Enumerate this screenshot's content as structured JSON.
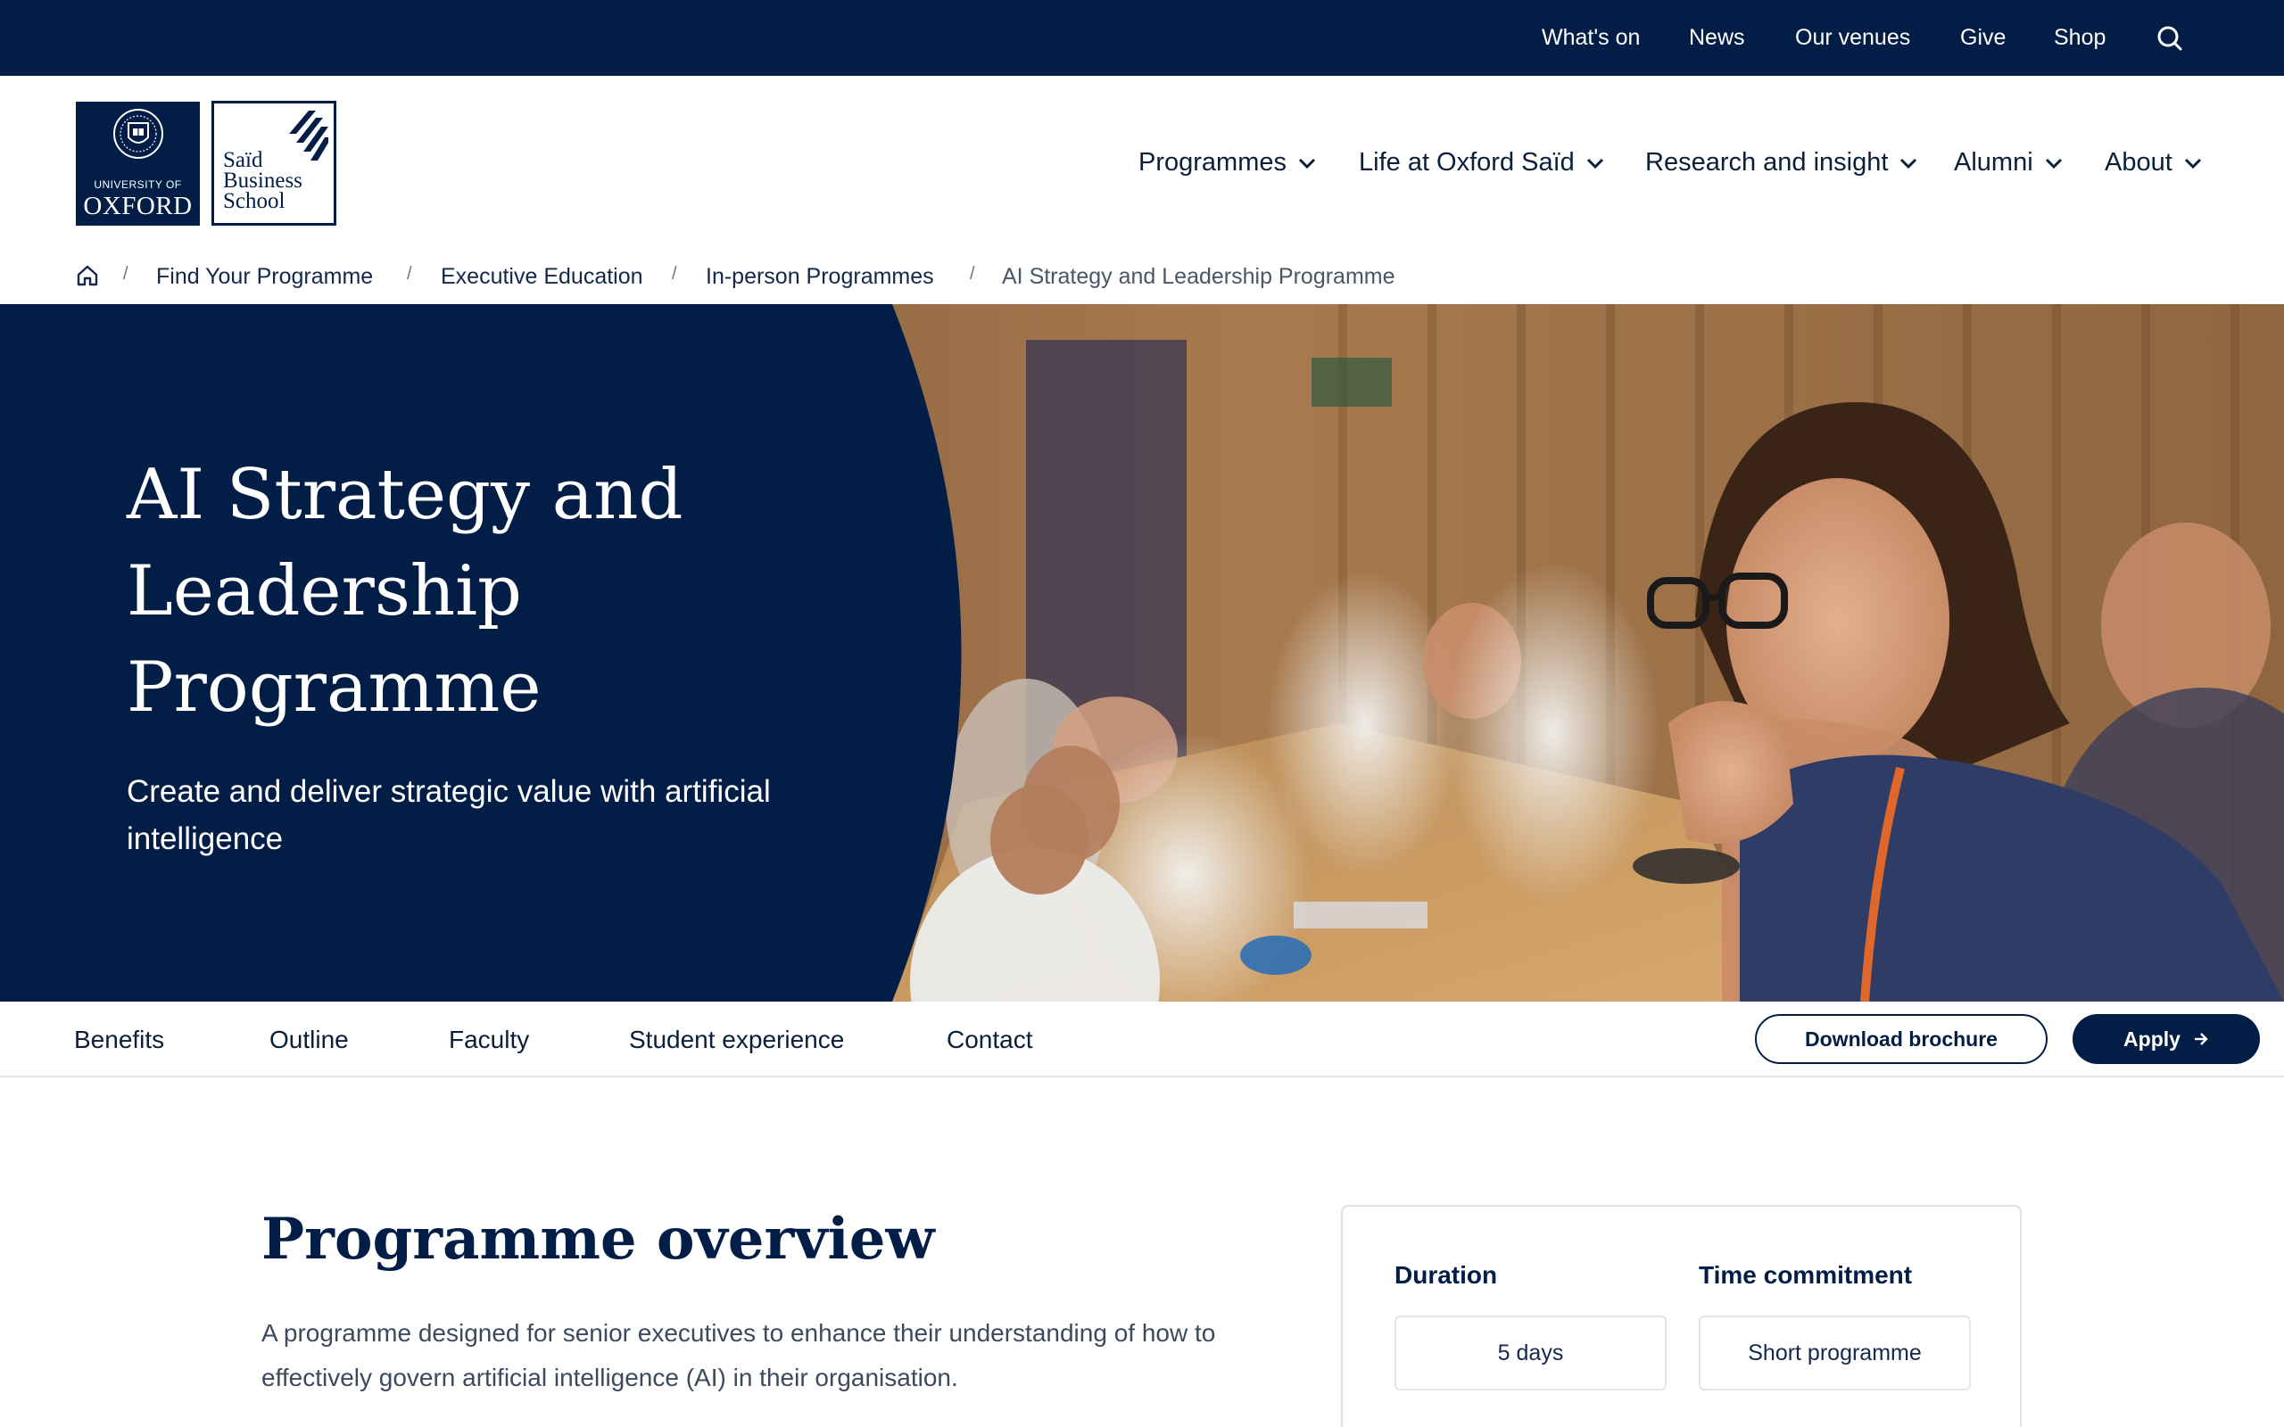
{
  "utility_nav": {
    "items": [
      "What's on",
      "News",
      "Our venues",
      "Give",
      "Shop"
    ],
    "search_icon": "search-icon"
  },
  "logos": {
    "oxford": {
      "line1": "UNIVERSITY OF",
      "line2": "OXFORD"
    },
    "said": {
      "line1": "Saïd",
      "line2": "Business",
      "line3": "School"
    }
  },
  "main_nav": {
    "items": [
      "Programmes",
      "Life at Oxford Saïd",
      "Research and insight",
      "Alumni",
      "About"
    ]
  },
  "breadcrumb": {
    "home_icon": "home-icon",
    "items": [
      "Find Your Programme",
      "Executive Education",
      "In-person Programmes"
    ],
    "current": "AI Strategy and Leadership Programme",
    "separator": "/"
  },
  "hero": {
    "title_lines": [
      "AI Strategy and",
      "Leadership",
      "Programme"
    ],
    "subtitle": "Create and deliver strategic value with artificial intelligence"
  },
  "page_nav": {
    "tabs": [
      "Benefits",
      "Outline",
      "Faculty",
      "Student experience",
      "Contact"
    ],
    "brochure_button": "Download brochure",
    "apply_button": "Apply"
  },
  "overview": {
    "title": "Programme overview",
    "text": "A programme designed for senior executives to enhance their understanding of how to effectively govern artificial intelligence (AI) in their organisation."
  },
  "key_facts": {
    "duration_label": "Duration",
    "duration_value": "5 days",
    "commitment_label": "Time commitment",
    "commitment_value": "Short programme"
  },
  "colors": {
    "navy": "#021e47",
    "text": "#0b1f3a",
    "muted": "#3d4a5e",
    "border": "#dfe3e8",
    "white": "#ffffff"
  }
}
